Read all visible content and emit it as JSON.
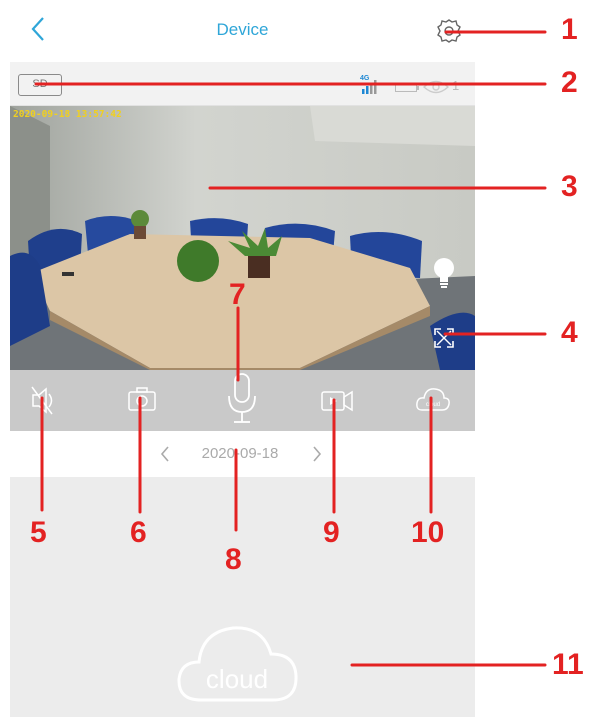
{
  "header": {
    "title": "Device",
    "back_icon": "chevron-left-icon",
    "settings_icon": "gear-icon"
  },
  "status": {
    "sd_label": "SD",
    "network_label": "4G",
    "viewer_count": "1"
  },
  "video": {
    "timestamp": "2020-09-18 13:57:42"
  },
  "date_nav": {
    "date": "2020-09-18"
  },
  "cloud": {
    "label": "cloud",
    "small_label": "cloud"
  },
  "annotations": [
    "1",
    "2",
    "3",
    "4",
    "5",
    "6",
    "7",
    "8",
    "9",
    "10",
    "11"
  ],
  "colors": {
    "accent": "#2fa6d8",
    "annotation": "#e32222",
    "control_bar": "#c9c9c9",
    "cloud_panel": "#ececec"
  }
}
